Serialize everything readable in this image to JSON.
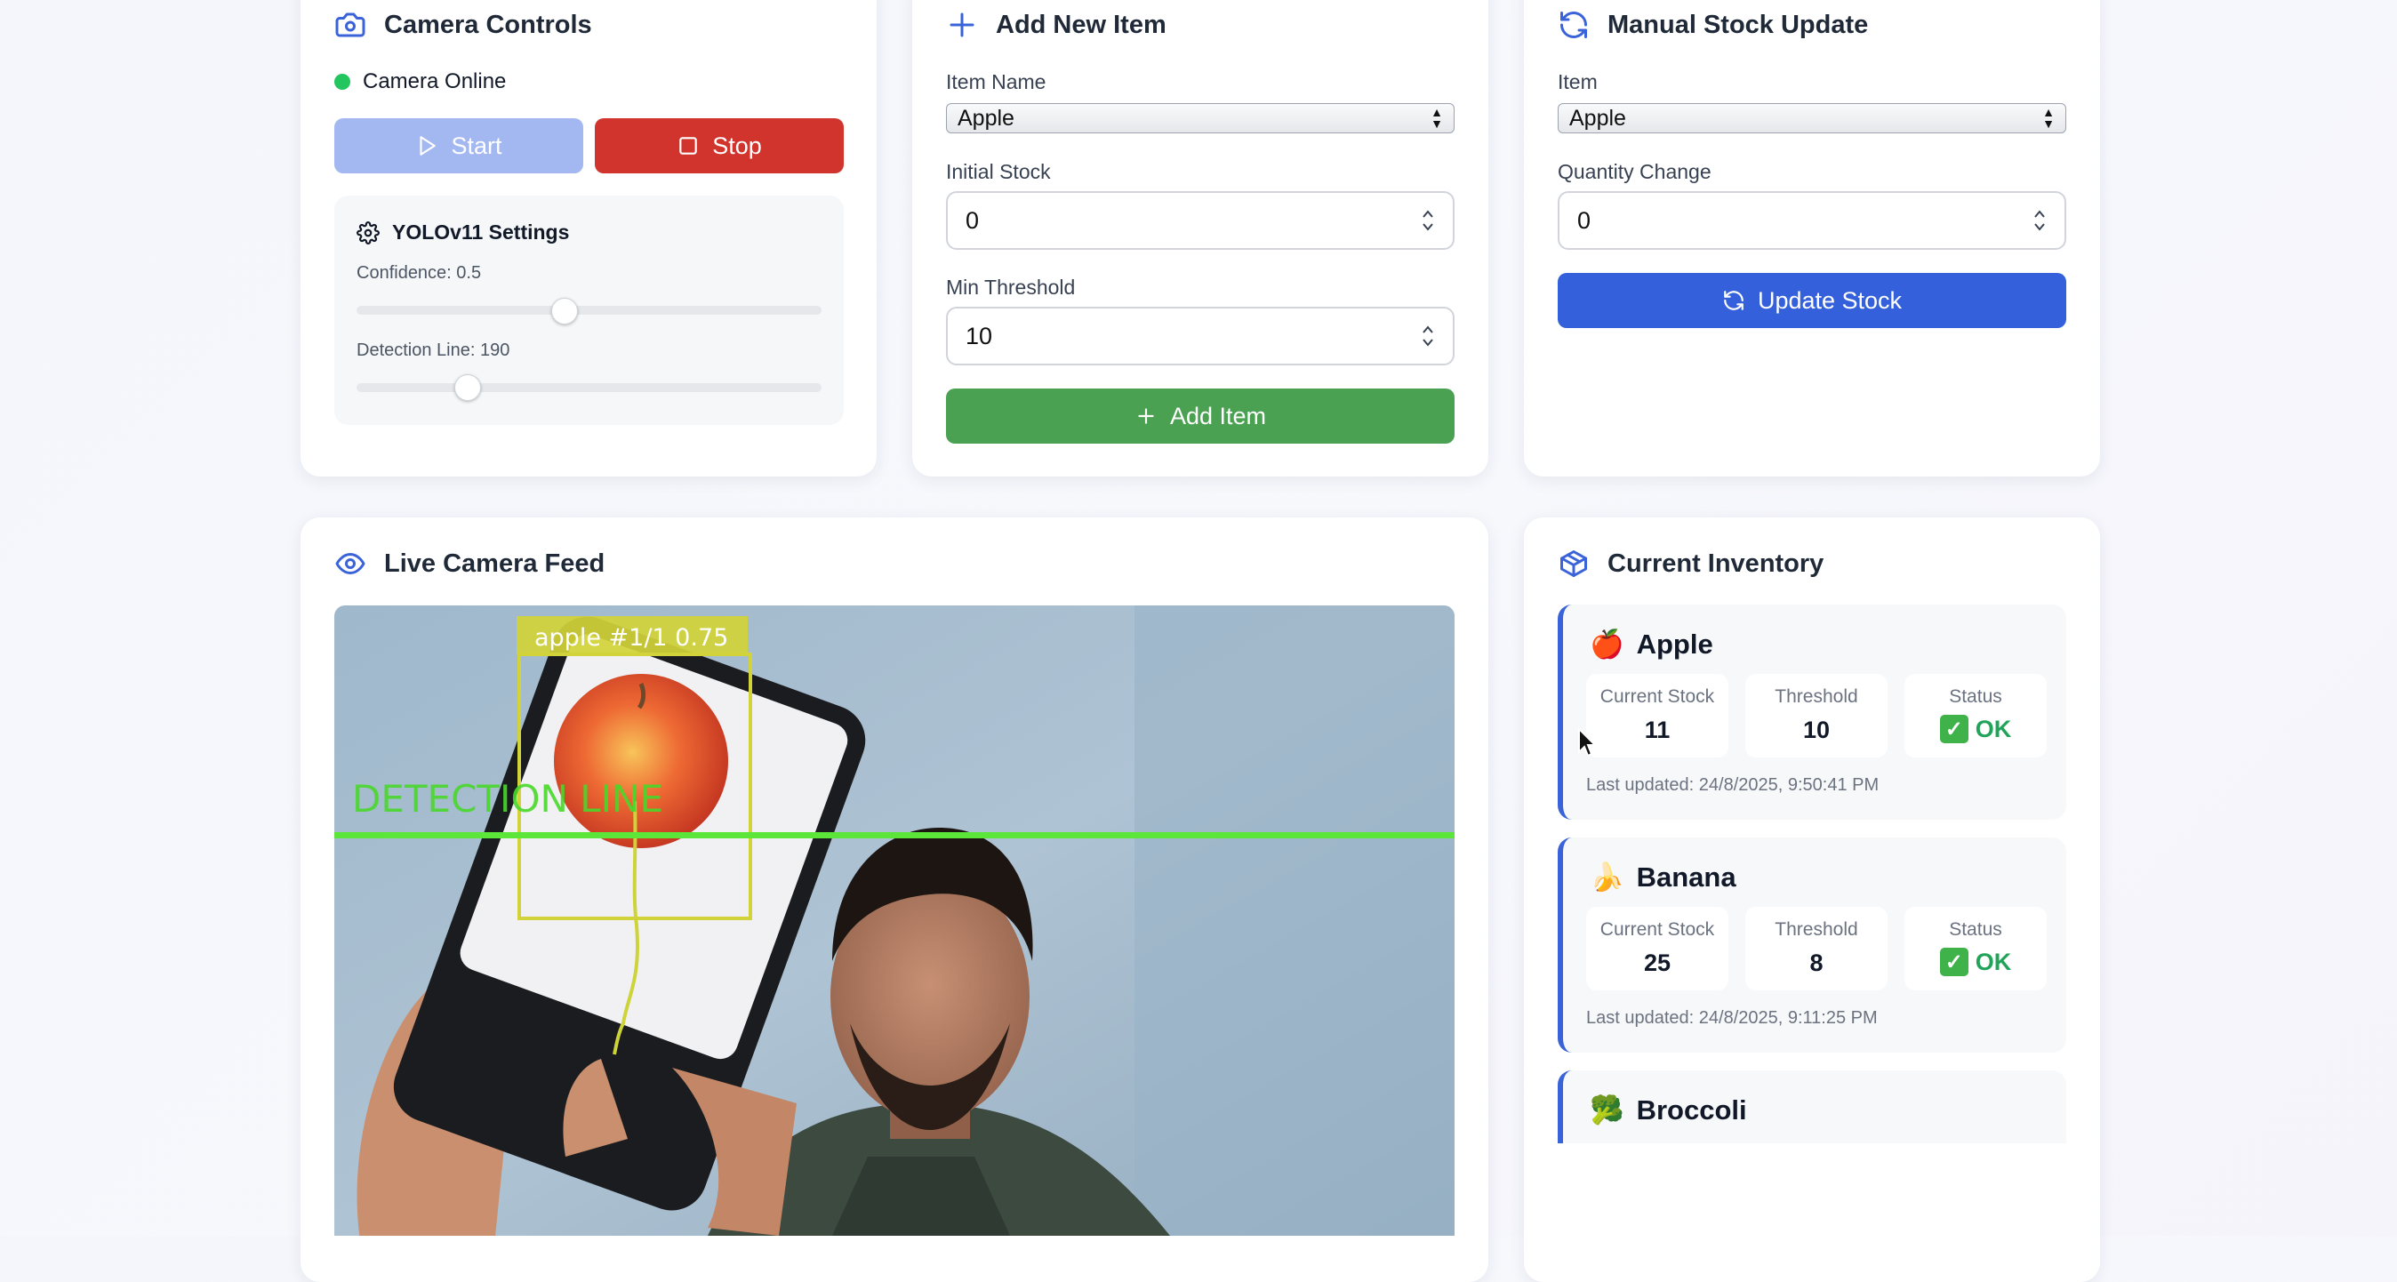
{
  "camera_controls": {
    "title": "Camera Controls",
    "status_text": "Camera Online",
    "status_color": "#22c55e",
    "start_label": "Start",
    "stop_label": "Stop",
    "settings": {
      "title": "YOLOv11 Settings",
      "confidence_label": "Confidence: 0.5",
      "confidence_value": 0.5,
      "detection_line_label": "Detection Line: 190",
      "detection_line_value": 190
    }
  },
  "add_item": {
    "title": "Add New Item",
    "item_name_label": "Item Name",
    "item_name_value": "Apple",
    "initial_stock_label": "Initial Stock",
    "initial_stock_value": "0",
    "min_threshold_label": "Min Threshold",
    "min_threshold_value": "10",
    "button_label": "Add Item"
  },
  "manual_update": {
    "title": "Manual Stock Update",
    "item_label": "Item",
    "item_value": "Apple",
    "quantity_label": "Quantity Change",
    "quantity_value": "0",
    "button_label": "Update Stock"
  },
  "live_feed": {
    "title": "Live Camera Feed",
    "overlay_detection_label": "apple #1/1 0.75",
    "overlay_line_label": "DETECTION LINE"
  },
  "inventory": {
    "title": "Current Inventory",
    "items": [
      {
        "emoji": "🍎",
        "name": "Apple",
        "current_stock_label": "Current Stock",
        "current_stock": "11",
        "threshold_label": "Threshold",
        "threshold": "10",
        "status_label": "Status",
        "status": "OK",
        "updated": "Last updated: 24/8/2025, 9:50:41 PM"
      },
      {
        "emoji": "🍌",
        "name": "Banana",
        "current_stock_label": "Current Stock",
        "current_stock": "25",
        "threshold_label": "Threshold",
        "threshold": "8",
        "status_label": "Status",
        "status": "OK",
        "updated": "Last updated: 24/8/2025, 9:11:25 PM"
      },
      {
        "emoji": "🥦",
        "name": "Broccoli"
      }
    ]
  },
  "colors": {
    "primary": "#3461db",
    "success": "#4aa151",
    "danger": "#d0342c",
    "start_disabled": "#a3b8f0"
  }
}
